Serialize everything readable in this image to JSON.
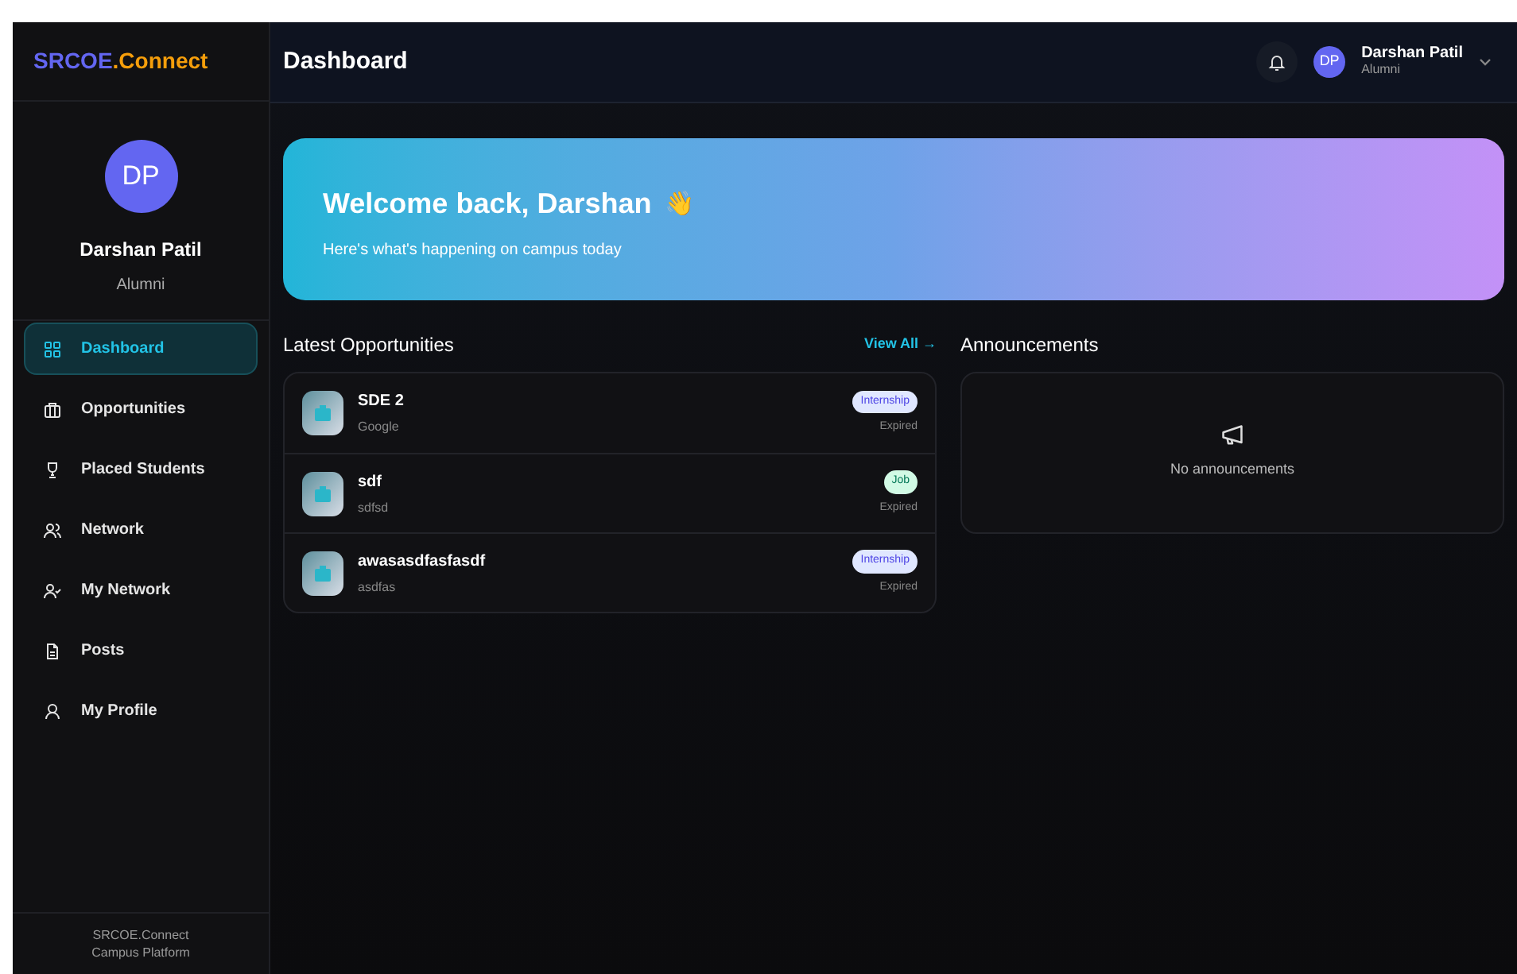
{
  "logo": [
    "SRCOE",
    ".Connect"
  ],
  "header": {
    "title": "Dashboard",
    "user": {
      "initials": "DP",
      "name": "Darshan Patil",
      "role": "Alumni"
    }
  },
  "sidebar": {
    "profile": {
      "initials": "DP",
      "name": "Darshan Patil",
      "role": "Alumni"
    },
    "items": [
      {
        "label": "Dashboard",
        "selected": true
      },
      {
        "label": "Opportunities",
        "selected": false
      },
      {
        "label": "Placed Students",
        "selected": false
      },
      {
        "label": "Network",
        "selected": false
      },
      {
        "label": "My Network",
        "selected": false
      },
      {
        "label": "Posts",
        "selected": false
      },
      {
        "label": "My Profile",
        "selected": false
      }
    ],
    "footer": [
      "SRCOE.Connect",
      "Campus Platform"
    ]
  },
  "banner": {
    "title": "Welcome back, Darshan",
    "emoji": "👋",
    "subtitle": "Here's what's happening on campus today"
  },
  "opportunities": {
    "heading": "Latest Opportunities",
    "link": "View All →",
    "rows": [
      {
        "title": "SDE 2",
        "company": "Google",
        "kind": "internship",
        "badge": "Internship",
        "status": "Expired"
      },
      {
        "title": "sdf",
        "company": "sdfsd",
        "kind": "job",
        "badge": "Job",
        "status": "Expired"
      },
      {
        "title": "awasasdfasfasdf",
        "company": "asdfas",
        "kind": "internship",
        "badge": "Internship",
        "status": "Expired"
      }
    ]
  },
  "announcements": {
    "heading": "Announcements",
    "empty": "No announcements"
  }
}
